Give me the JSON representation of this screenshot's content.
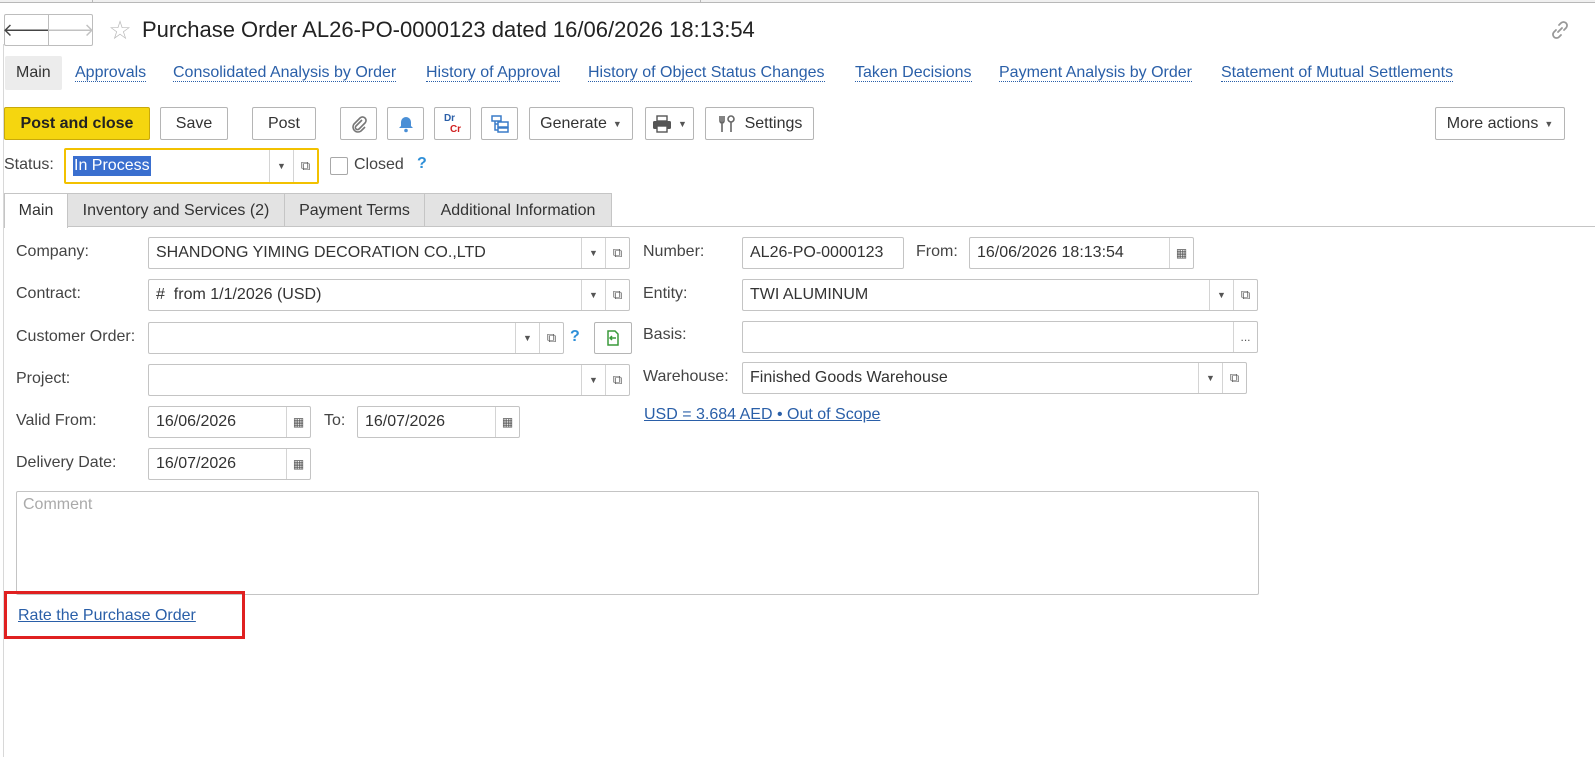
{
  "header": {
    "title": "Purchase Order AL26-PO-0000123 dated 16/06/2026 18:13:54",
    "back_label": "🡐",
    "forward_label": "🡒"
  },
  "section_tabs": [
    "Main",
    "Approvals",
    "Consolidated Analysis by Order",
    "History of Approval",
    "History of Object Status Changes",
    "Taken Decisions",
    "Payment Analysis by Order",
    "Statement of Mutual Settlements"
  ],
  "toolbar": {
    "post_and_close": "Post and close",
    "save": "Save",
    "post": "Post",
    "dr": "Dr",
    "cr": "Cr",
    "generate": "Generate",
    "settings": "Settings",
    "more_actions": "More actions"
  },
  "status": {
    "label": "Status:",
    "value": "In Process",
    "closed_label": "Closed",
    "closed_checked": false,
    "help": "?"
  },
  "tabs": [
    "Main",
    "Inventory and Services (2)",
    "Payment Terms",
    "Additional Information"
  ],
  "form": {
    "company_label": "Company:",
    "company_value": "SHANDONG YIMING DECORATION CO.,LTD",
    "contract_label": "Contract:",
    "contract_value": "#  from 1/1/2026 (USD)",
    "customer_order_label": "Customer Order:",
    "customer_order_value": "",
    "project_label": "Project:",
    "project_value": "",
    "valid_from_label": "Valid From:",
    "valid_from_value": "16/06/2026",
    "to_label": "To:",
    "to_value": "16/07/2026",
    "delivery_date_label": "Delivery Date:",
    "delivery_date_value": "16/07/2026",
    "number_label": "Number:",
    "number_value": "AL26-PO-0000123",
    "from_label": "From:",
    "from_value": "16/06/2026 18:13:54",
    "entity_label": "Entity:",
    "entity_value": "TWI ALUMINUM",
    "basis_label": "Basis:",
    "basis_value": "",
    "basis_btn": "...",
    "warehouse_label": "Warehouse:",
    "warehouse_value": "Finished Goods Warehouse",
    "exchange_rate_link": "USD = 3.684 AED • Out of Scope",
    "comment_placeholder": "Comment",
    "help": "?"
  },
  "rate_link": "Rate the Purchase Order",
  "colors": {
    "primary_button": "#f5d60f",
    "link": "#2a5fa8",
    "focus_border": "#f2c100",
    "highlight_box": "#e02020",
    "selection": "#3a6fcf"
  }
}
